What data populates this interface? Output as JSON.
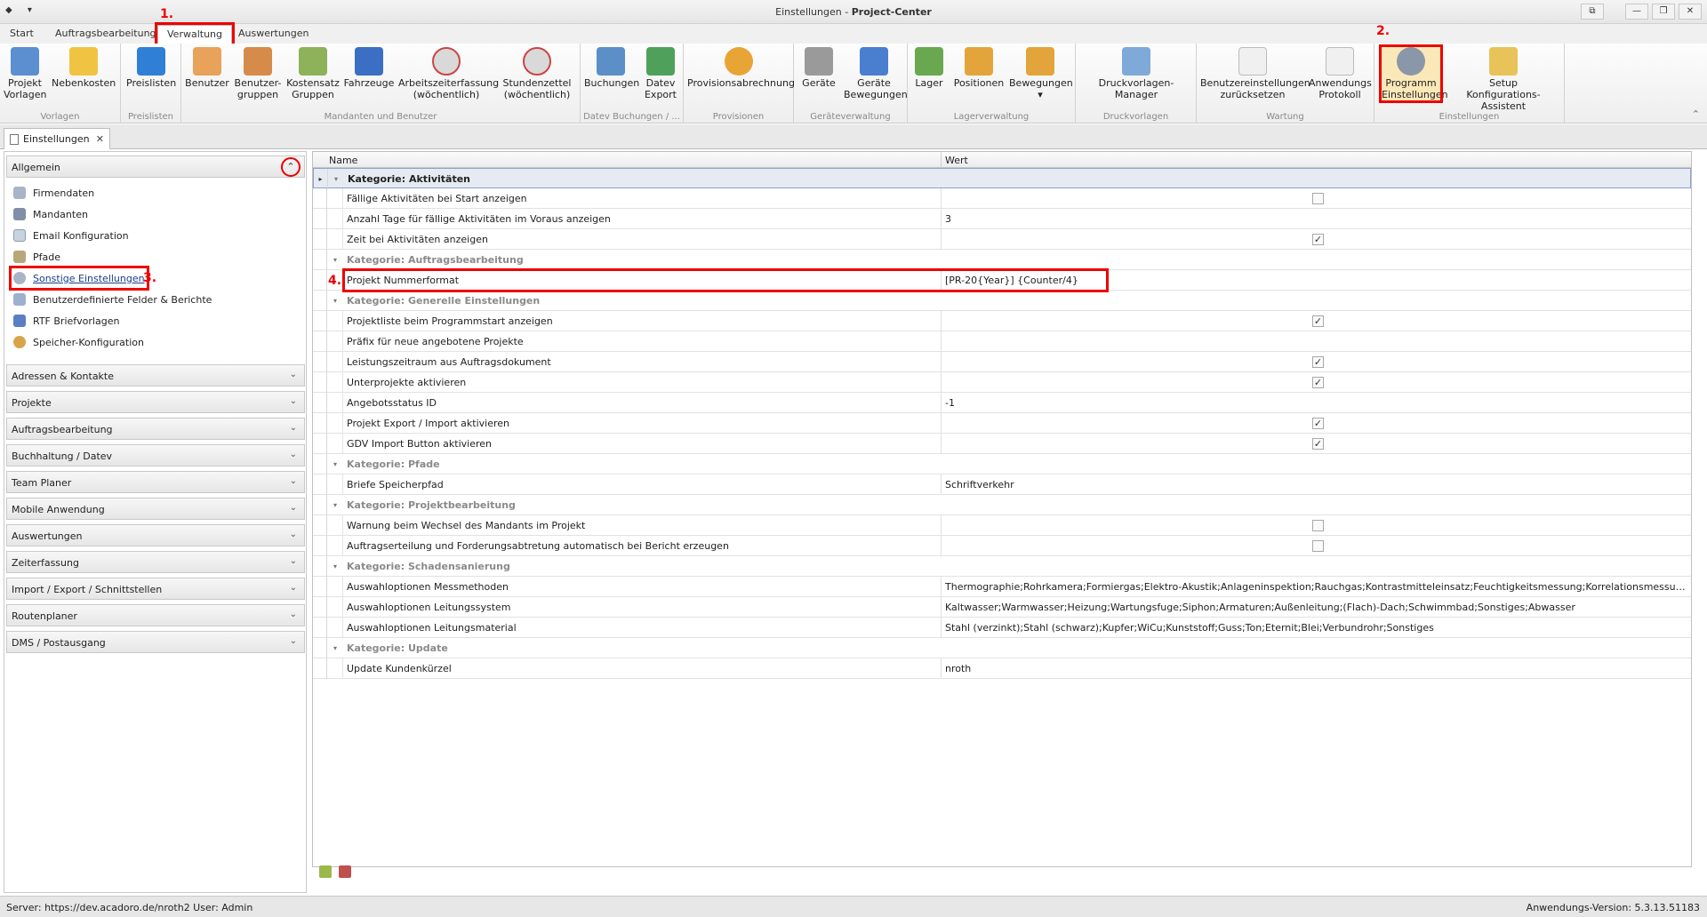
{
  "window": {
    "title_prefix": "Einstellungen -",
    "title_app": "Project-Center",
    "buttons": [
      "⧉",
      "—",
      "❐",
      "✕"
    ]
  },
  "qat": [
    "◆",
    "▾"
  ],
  "ribbon_tabs": [
    "Start",
    "Auftragsbearbeitung",
    "Verwaltung",
    "Auswertungen"
  ],
  "annotations": {
    "step1": "1.",
    "step2": "2.",
    "step3": "3.",
    "step4": "4."
  },
  "ribbon": {
    "groups": [
      {
        "label": "Vorlagen",
        "buttons": [
          "Projekt\nVorlagen",
          "Nebenkosten"
        ]
      },
      {
        "label": "Preislisten",
        "buttons": [
          "Preislisten"
        ]
      },
      {
        "label": "Mandanten und Benutzer",
        "buttons": [
          "Benutzer",
          "Benutzer-\ngruppen",
          "Kostensatz\nGruppen",
          "Fahrzeuge",
          "Arbeitszeiterfassung\n(wöchentlich)",
          "Stundenzettel\n(wöchentlich)"
        ]
      },
      {
        "label": "Datev Buchungen / ...",
        "buttons": [
          "Buchungen",
          "Datev\nExport"
        ]
      },
      {
        "label": "Provisionen",
        "buttons": [
          "Provisionsabrechnung"
        ]
      },
      {
        "label": "Geräteverwaltung",
        "buttons": [
          "Geräte",
          "Geräte\nBewegungen"
        ]
      },
      {
        "label": "Lagerverwaltung",
        "buttons": [
          "Lager",
          "Positionen",
          "Bewegungen\n▾"
        ]
      },
      {
        "label": "Druckvorlagen",
        "buttons": [
          "Druckvorlagen-Manager"
        ]
      },
      {
        "label": "Wartung",
        "buttons": [
          "Benutzereinstellungen\nzurücksetzen",
          "Anwendungs\nProtokoll"
        ]
      },
      {
        "label": "Einstellungen",
        "buttons": [
          "Programm\nEinstellungen",
          "Setup\nKonfigurations-Assistent"
        ]
      }
    ],
    "collapse_glyph": "⌃"
  },
  "doc_tab": {
    "label": "Einstellungen",
    "close": "✕"
  },
  "left_panel": {
    "open_section": "Allgemein",
    "items": [
      "Firmendaten",
      "Mandanten",
      "Email Konfiguration",
      "Pfade",
      "Sonstige Einstellungen",
      "Benutzerdefinierte Felder & Berichte",
      "RTF Briefvorlagen",
      "Speicher-Konfiguration"
    ],
    "sections": [
      "Adressen & Kontakte",
      "Projekte",
      "Auftragsbearbeitung",
      "Buchhaltung / Datev",
      "Team Planer",
      "Mobile Anwendung",
      "Auswertungen",
      "Zeiterfassung",
      "Import / Export / Schnittstellen",
      "Routenplaner",
      "DMS / Postausgang"
    ]
  },
  "grid": {
    "col_name": "Name",
    "col_value": "Wert",
    "rows": [
      {
        "type": "cat",
        "name": "Kategorie: Aktivitäten"
      },
      {
        "type": "prop",
        "name": "Fällige Aktivitäten bei Start anzeigen",
        "check": false
      },
      {
        "type": "prop",
        "name": "Anzahl Tage für fällige Aktivitäten im Voraus anzeigen",
        "value": "3"
      },
      {
        "type": "prop",
        "name": "Zeit bei Aktivitäten anzeigen",
        "check": true
      },
      {
        "type": "cat",
        "name": "Kategorie: Auftragsbearbeitung"
      },
      {
        "type": "prop",
        "name": "Projekt Nummerformat",
        "value": "[PR-20{Year}] {Counter/4}"
      },
      {
        "type": "cat",
        "name": "Kategorie: Generelle Einstellungen"
      },
      {
        "type": "prop",
        "name": "Projektliste beim Programmstart anzeigen",
        "check": true
      },
      {
        "type": "prop",
        "name": "Präfix für neue angebotene Projekte",
        "value": ""
      },
      {
        "type": "prop",
        "name": "Leistungszeitraum aus Auftragsdokument",
        "check": true
      },
      {
        "type": "prop",
        "name": "Unterprojekte aktivieren",
        "check": true
      },
      {
        "type": "prop",
        "name": "Angebotsstatus ID",
        "value": "-1"
      },
      {
        "type": "prop",
        "name": "Projekt Export / Import aktivieren",
        "check": true
      },
      {
        "type": "prop",
        "name": "GDV Import Button aktivieren",
        "check": true
      },
      {
        "type": "cat",
        "name": "Kategorie: Pfade"
      },
      {
        "type": "prop",
        "name": "Briefe Speicherpfad",
        "value": "Schriftverkehr"
      },
      {
        "type": "cat",
        "name": "Kategorie: Projektbearbeitung"
      },
      {
        "type": "prop",
        "name": "Warnung beim Wechsel des Mandants im Projekt",
        "check": false
      },
      {
        "type": "prop",
        "name": "Auftragserteilung und Forderungsabtretung automatisch bei Bericht erzeugen",
        "check": false
      },
      {
        "type": "cat",
        "name": "Kategorie: Schadensanierung"
      },
      {
        "type": "prop",
        "name": "Auswahloptionen Messmethoden",
        "value": "Thermographie;Rohrkamera;Formiergas;Elektro-Akustik;Anlageninspektion;Rauchgas;Kontrastmitteleinsatz;Feuchtigkeitsmessung;Korrelationsmessung;Endoskopie;Druckluft"
      },
      {
        "type": "prop",
        "name": "Auswahloptionen Leitungssystem",
        "value": "Kaltwasser;Warmwasser;Heizung;Wartungsfuge;Siphon;Armaturen;Außenleitung;(Flach)-Dach;Schwimmbad;Sonstiges;Abwasser"
      },
      {
        "type": "prop",
        "name": "Auswahloptionen Leitungsmaterial",
        "value": "Stahl (verzinkt);Stahl (schwarz);Kupfer;WiCu;Kunststoff;Guss;Ton;Eternit;Blei;Verbundrohr;Sonstiges"
      },
      {
        "type": "cat",
        "name": "Kategorie: Update"
      },
      {
        "type": "prop",
        "name": "Update Kundenkürzel",
        "value": "nroth"
      }
    ]
  },
  "status": {
    "left": "Server: https://dev.acadoro.de/nroth2   User: Admin",
    "right": "Anwendungs-Version: 5.3.13.51183"
  },
  "colors": {
    "highlight": "#e00000",
    "selection": "#e6eaf3"
  }
}
